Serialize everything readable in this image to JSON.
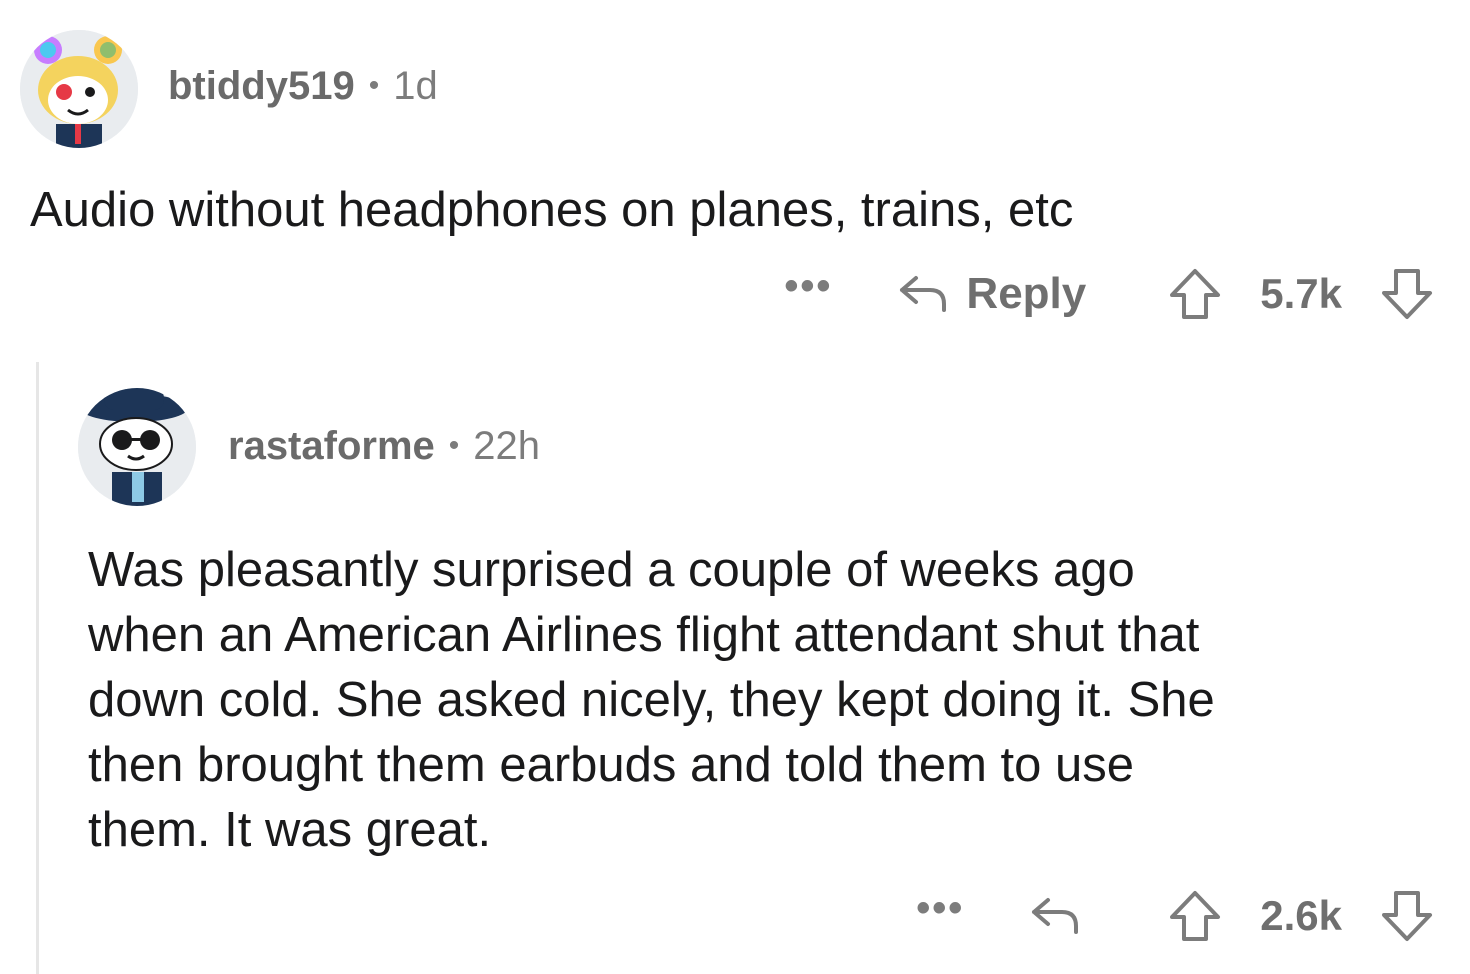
{
  "comments": [
    {
      "username": "btiddy519",
      "separator": "•",
      "age": "1d",
      "body": "Audio without headphones on planes, trains, etc",
      "actions": {
        "more_label": "•••",
        "reply_label": "Reply",
        "score": "5.7k"
      }
    },
    {
      "username": "rastaforme",
      "separator": "•",
      "age": "22h",
      "body_lines": [
        "Was pleasantly surprised a couple of weeks ago",
        "when an American Airlines flight attendant shut that",
        "down cold. She asked nicely, they kept doing it. She",
        "then brought them earbuds and told them to use",
        "them. It was great."
      ],
      "actions": {
        "more_label": "•••",
        "score": "2.6k"
      }
    }
  ],
  "colors": {
    "text": "#1a1a1b",
    "meta": "#7c7c7c",
    "thread_line": "#e6e6e6"
  },
  "icons": {
    "reply": "reply-arrow-icon",
    "upvote": "upvote-arrow-icon",
    "downvote": "downvote-arrow-icon",
    "more": "more-dots-icon"
  }
}
